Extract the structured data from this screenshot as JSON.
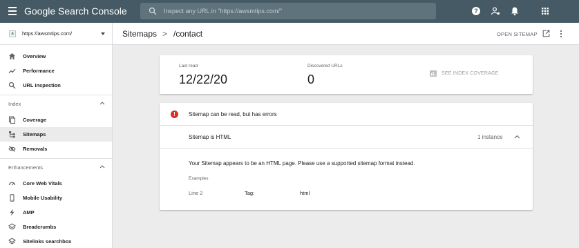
{
  "app": {
    "title": "Google Search Console"
  },
  "search": {
    "placeholder": "Inspect any URL in \"https://awsmtips.com/\""
  },
  "topbar": {
    "icons": [
      "help-icon",
      "account-settings-icon",
      "notifications-icon",
      "apps-grid-icon"
    ]
  },
  "property": {
    "label": "https://awsmtips.com/",
    "badge": "a"
  },
  "sidebar": {
    "items": [
      {
        "label": "Overview",
        "icon": "home-icon"
      },
      {
        "label": "Performance",
        "icon": "trending-icon"
      },
      {
        "label": "URL inspection",
        "icon": "search-icon"
      }
    ],
    "index": {
      "label": "Index",
      "items": [
        {
          "label": "Coverage",
          "icon": "coverage-icon"
        },
        {
          "label": "Sitemaps",
          "icon": "sitemap-icon",
          "active": true
        },
        {
          "label": "Removals",
          "icon": "removals-icon"
        }
      ]
    },
    "enhancements": {
      "label": "Enhancements",
      "items": [
        {
          "label": "Core Web Vitals",
          "icon": "speed-icon"
        },
        {
          "label": "Mobile Usability",
          "icon": "mobile-icon"
        },
        {
          "label": "AMP",
          "icon": "bolt-icon"
        },
        {
          "label": "Breadcrumbs",
          "icon": "layers-icon"
        },
        {
          "label": "Sitelinks searchbox",
          "icon": "layers-icon"
        }
      ]
    }
  },
  "header": {
    "crumb_root": "Sitemaps",
    "crumb_sep": ">",
    "crumb_current": "/contact",
    "open_sitemap": "OPEN SITEMAP"
  },
  "stats": {
    "last_read_label": "Last read",
    "last_read_value": "12/22/20",
    "discovered_label": "Discovered URLs",
    "discovered_value": "0",
    "coverage_link": "SEE INDEX COVERAGE"
  },
  "errors": {
    "title": "Sitemap can be read, but has errors",
    "issue": {
      "title": "Sitemap is HTML",
      "count": "1 instance",
      "description": "Your Sitemap appears to be an HTML page. Please use a supported sitemap format instead.",
      "examples_label": "Examples",
      "example": {
        "line": "Line 2",
        "tag_label": "Tag:",
        "tag_value": "html"
      }
    }
  },
  "colors": {
    "topbar": "#455a64",
    "error": "#d93025",
    "background": "#ececec"
  }
}
